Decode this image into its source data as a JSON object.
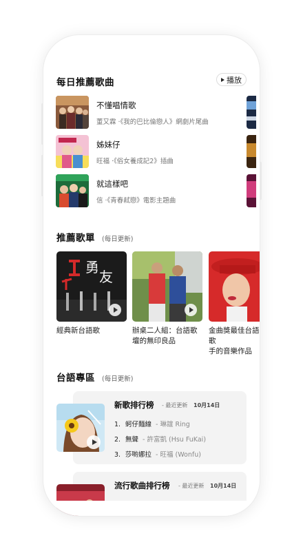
{
  "daily": {
    "title": "每日推薦歌曲",
    "play_label": "播放",
    "songs": [
      {
        "title": "不懂唱情歌",
        "meta": "董又霖 ·《我的巴比倫戀人》網劇片尾曲"
      },
      {
        "title": "姊妹仔",
        "meta": "旺福 ·《俗女養成記2》插曲"
      },
      {
        "title": "就這樣吧",
        "meta": "信 ·《青春弒戀》電影主題曲"
      }
    ]
  },
  "playlists": {
    "title": "推薦歌單",
    "subtitle": "(每日更新)",
    "items": [
      {
        "name": "經典新台語歌"
      },
      {
        "name": "辦桌二人組：台語歌\n壇的無印良品"
      },
      {
        "name": "金曲獎最佳台語歌\n手的音樂作品"
      }
    ]
  },
  "taiwanese": {
    "title": "台語專區",
    "subtitle": "(每日更新)",
    "charts": [
      {
        "title": "新歌排行榜",
        "updated_label": "- 最近更新",
        "date": "10月14日",
        "ranks": [
          {
            "num": "1.",
            "song": "蚵仔麵線",
            "artist": "- 琳誼 Ring"
          },
          {
            "num": "2.",
            "song": "無聲",
            "artist": "- 許富凱 (Hsu FuKai)"
          },
          {
            "num": "3.",
            "song": "莎喲娜拉",
            "artist": "- 旺福 (Wonfu)"
          }
        ]
      },
      {
        "title": "流行歌曲排行榜",
        "updated_label": "- 最近更新",
        "date": "10月14日"
      }
    ]
  },
  "colors": {
    "text": "#111111",
    "muted": "#777777",
    "card": "#f3f3f3"
  }
}
